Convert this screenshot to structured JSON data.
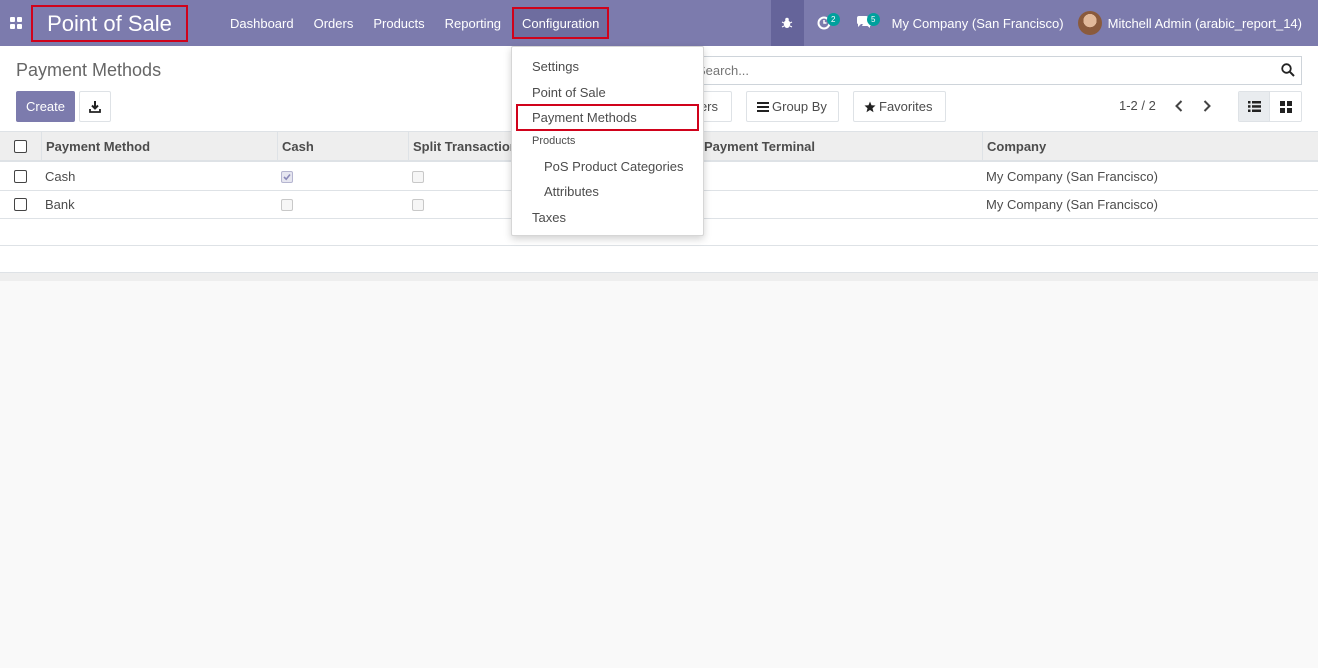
{
  "navbar": {
    "app_name": "Point of Sale",
    "menu": {
      "dashboard": "Dashboard",
      "orders": "Orders",
      "products": "Products",
      "reporting": "Reporting",
      "configuration": "Configuration"
    },
    "activity_count": "2",
    "messages_count": "5",
    "company": "My Company (San Francisco)",
    "user": "Mitchell Admin (arabic_report_14)"
  },
  "control_panel": {
    "title": "Payment Methods",
    "create_label": "Create",
    "search_placeholder": "Search...",
    "filters_label": "ers",
    "groupby_label": "Group By",
    "favorites_label": "Favorites",
    "pager": "1-2 / 2"
  },
  "table": {
    "columns": {
      "name": "Payment Method",
      "cash": "Cash",
      "split": "Split Transactions",
      "terminal": "Payment Terminal",
      "company": "Company"
    },
    "rows": [
      {
        "name": "Cash",
        "cash": true,
        "split": false,
        "company": "My Company (San Francisco)"
      },
      {
        "name": "Bank",
        "cash": false,
        "split": false,
        "company": "My Company (San Francisco)"
      }
    ]
  },
  "config_menu": {
    "settings": "Settings",
    "point_of_sale": "Point of Sale",
    "payment_methods": "Payment Methods",
    "products_header": "Products",
    "pos_product_categories": "PoS Product Categories",
    "attributes": "Attributes",
    "taxes": "Taxes"
  },
  "colors": {
    "navbar": "#7c7bad",
    "highlight": "#d0021b",
    "badge": "#00a09d"
  }
}
